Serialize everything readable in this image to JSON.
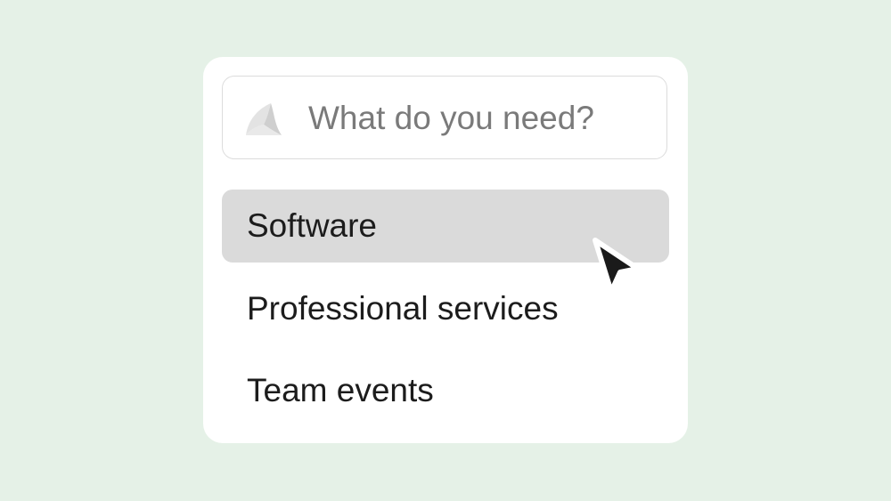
{
  "search": {
    "placeholder": "What do you need?",
    "icon": "search-icon"
  },
  "menu": {
    "items": [
      {
        "label": "Software",
        "highlighted": true
      },
      {
        "label": "Professional services",
        "highlighted": false
      },
      {
        "label": "Team events",
        "highlighted": false
      }
    ]
  },
  "pointer": {
    "icon": "mouse-cursor-icon"
  },
  "colors": {
    "background": "#e5f1e7",
    "card": "#ffffff",
    "highlight": "#dadada",
    "text": "#1c1c1c",
    "placeholder": "#7a7a7a"
  }
}
